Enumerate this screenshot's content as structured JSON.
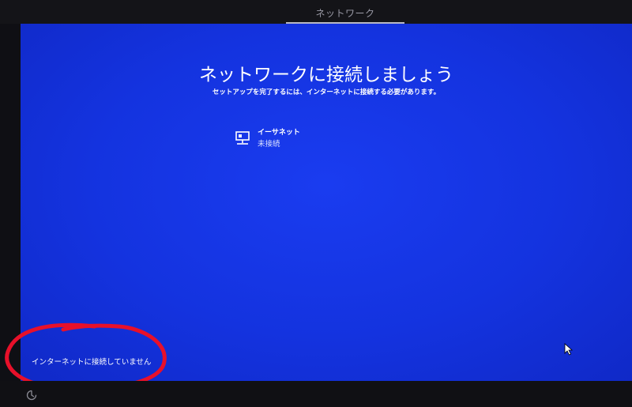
{
  "header": {
    "step_label": "ネットワーク"
  },
  "main": {
    "title": "ネットワークに接続しましょう",
    "subtitle": "セットアップを完了するには、インターネットに接続する必要があります。",
    "network": {
      "name": "イーサネット",
      "status": "未接続",
      "icon": "ethernet-icon"
    }
  },
  "footer": {
    "status_text": "インターネットに接続していません",
    "accessibility_icon": "ease-of-access-icon"
  },
  "colors": {
    "background_blue": "#1433df",
    "text": "#ffffff",
    "annotation_red": "#e8102a"
  }
}
